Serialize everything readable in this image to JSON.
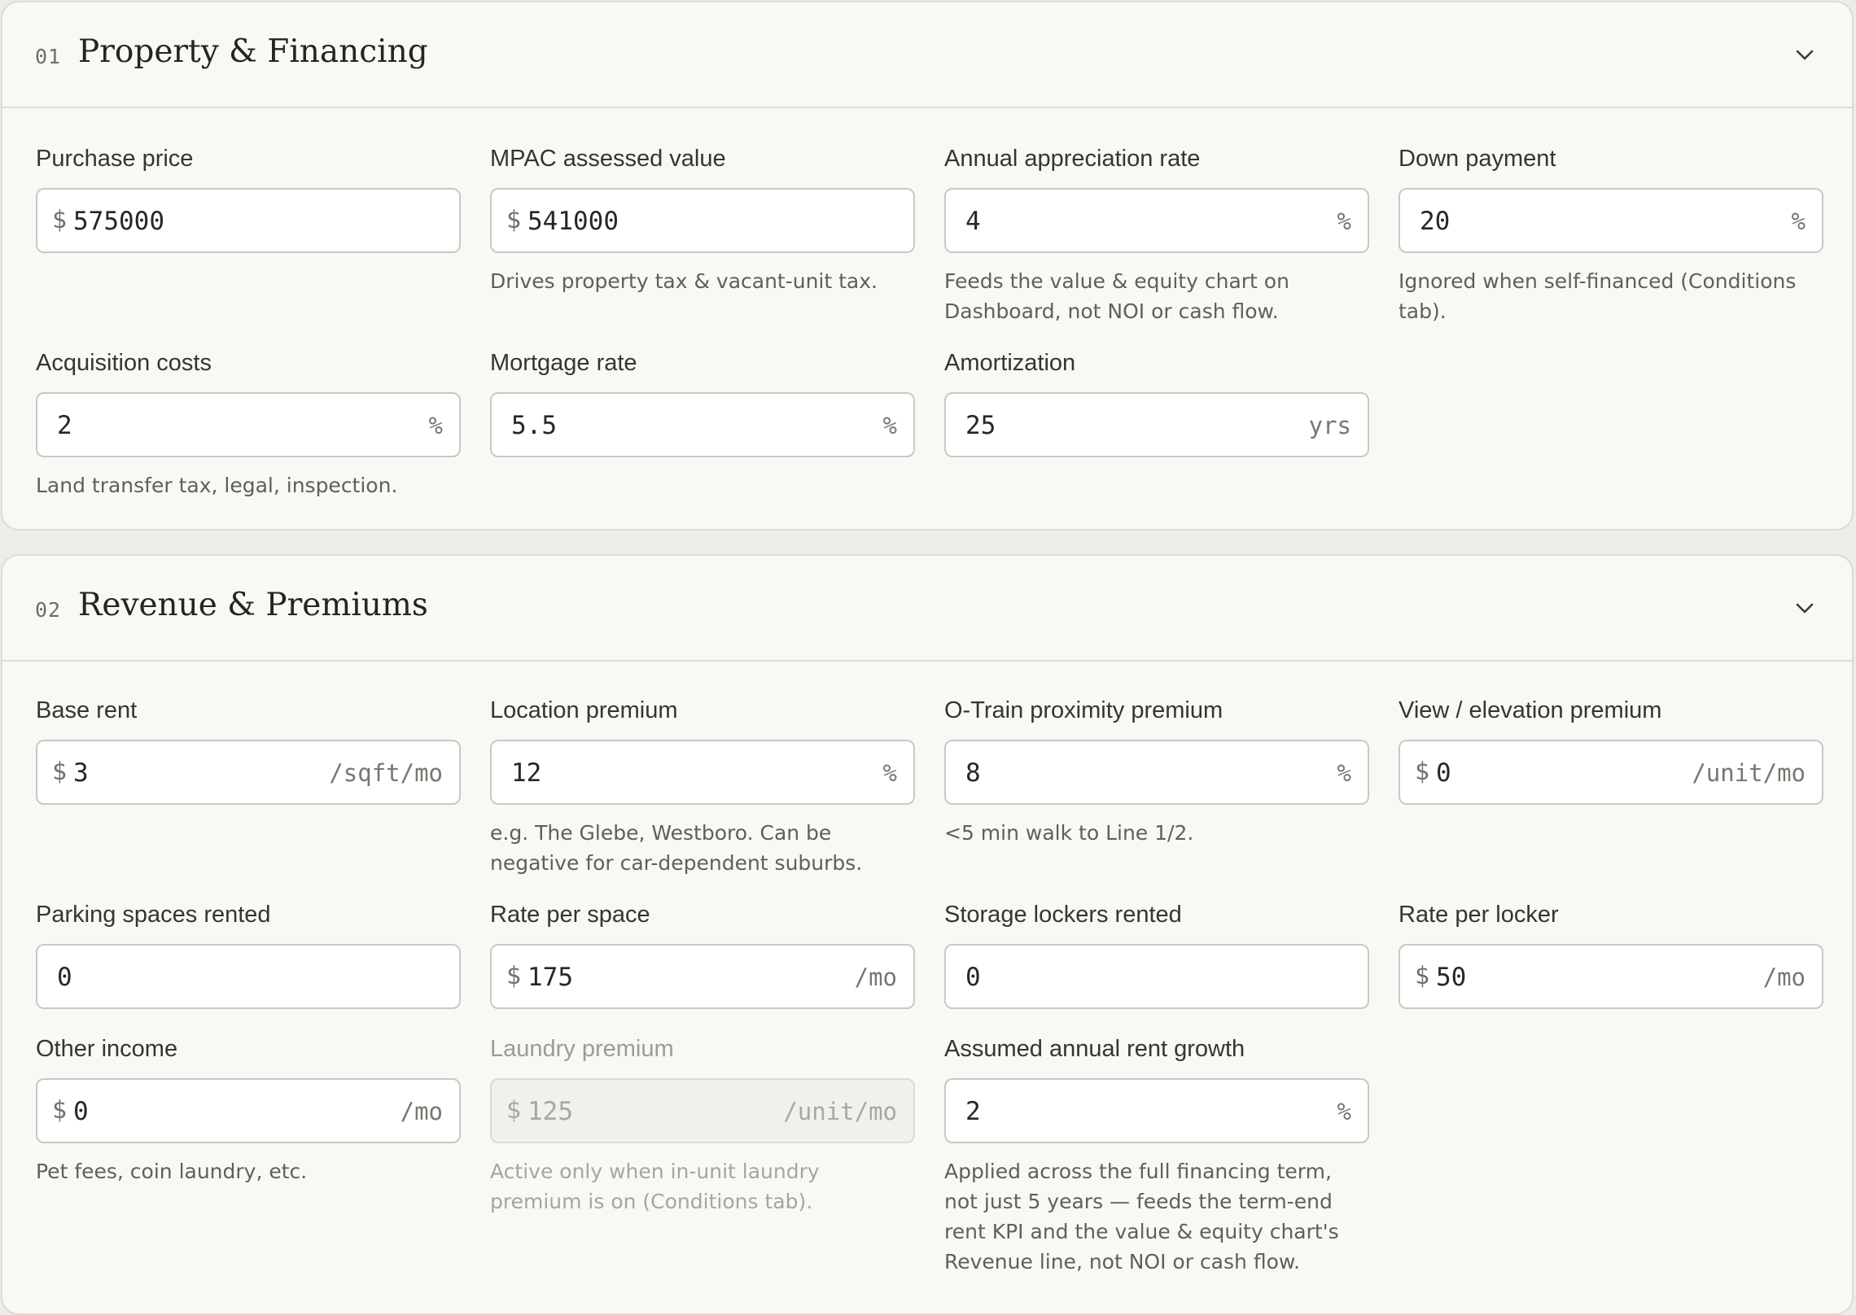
{
  "sections": [
    {
      "number": "01",
      "title": "Property & Financing",
      "fields": [
        {
          "label": "Purchase price",
          "prefix": "$",
          "value": "575000",
          "suffix": "",
          "hint": ""
        },
        {
          "label": "MPAC assessed value",
          "prefix": "$",
          "value": "541000",
          "suffix": "",
          "hint": "Drives property tax & vacant-unit tax."
        },
        {
          "label": "Annual appreciation rate",
          "prefix": "",
          "value": "4",
          "suffix": "%",
          "hint": "Feeds the value & equity chart on Dashboard, not NOI or cash flow."
        },
        {
          "label": "Down payment",
          "prefix": "",
          "value": "20",
          "suffix": "%",
          "hint": "Ignored when self-financed (Conditions tab)."
        },
        {
          "label": "Acquisition costs",
          "prefix": "",
          "value": "2",
          "suffix": "%",
          "hint": "Land transfer tax, legal, inspection."
        },
        {
          "label": "Mortgage rate",
          "prefix": "",
          "value": "5.5",
          "suffix": "%",
          "hint": ""
        },
        {
          "label": "Amortization",
          "prefix": "",
          "value": "25",
          "suffix": "yrs",
          "hint": ""
        }
      ]
    },
    {
      "number": "02",
      "title": "Revenue & Premiums",
      "fields": [
        {
          "label": "Base rent",
          "prefix": "$",
          "value": "3",
          "suffix": "/sqft/mo",
          "hint": ""
        },
        {
          "label": "Location premium",
          "prefix": "",
          "value": "12",
          "suffix": "%",
          "hint": "e.g. The Glebe, Westboro. Can be negative for car-dependent suburbs."
        },
        {
          "label": "O-Train proximity premium",
          "prefix": "",
          "value": "8",
          "suffix": "%",
          "hint": "<5 min walk to Line 1/2."
        },
        {
          "label": "View / elevation premium",
          "prefix": "$",
          "value": "0",
          "suffix": "/unit/mo",
          "hint": ""
        },
        {
          "label": "Parking spaces rented",
          "prefix": "",
          "value": "0",
          "suffix": "",
          "hint": ""
        },
        {
          "label": "Rate per space",
          "prefix": "$",
          "value": "175",
          "suffix": "/mo",
          "hint": ""
        },
        {
          "label": "Storage lockers rented",
          "prefix": "",
          "value": "0",
          "suffix": "",
          "hint": ""
        },
        {
          "label": "Rate per locker",
          "prefix": "$",
          "value": "50",
          "suffix": "/mo",
          "hint": ""
        },
        {
          "label": "Other income",
          "prefix": "$",
          "value": "0",
          "suffix": "/mo",
          "hint": "Pet fees, coin laundry, etc."
        },
        {
          "label": "Laundry premium",
          "prefix": "$",
          "value": "125",
          "suffix": "/unit/mo",
          "hint": "Active only when in-unit laundry premium is on (Conditions tab).",
          "disabled": true
        },
        {
          "label": "Assumed annual rent growth",
          "prefix": "",
          "value": "2",
          "suffix": "%",
          "hint": "Applied across the full financing term, not just 5 years — feeds the term-end rent KPI and the value & equity chart's Revenue line, not NOI or cash flow."
        }
      ]
    }
  ]
}
